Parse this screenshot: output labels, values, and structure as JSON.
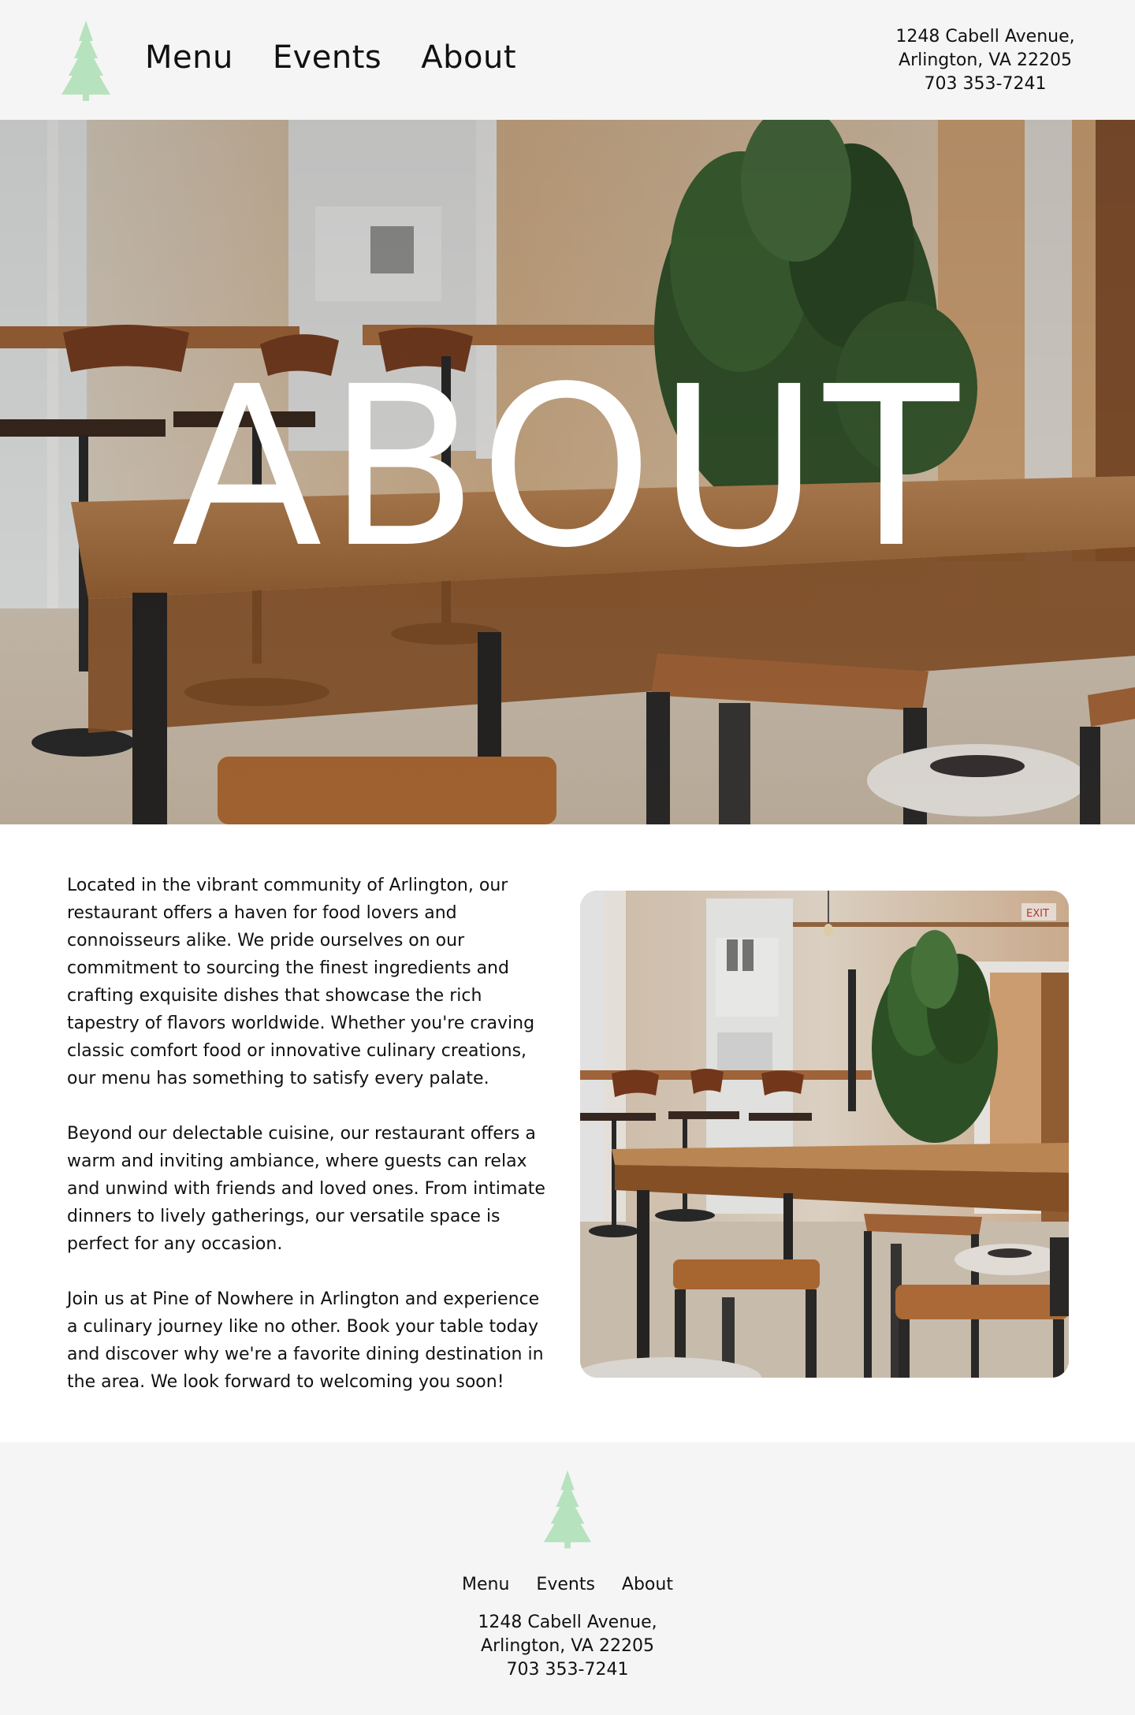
{
  "brand": {
    "logo_icon": "pine-tree-icon",
    "logo_color": "#b6e2bd"
  },
  "header": {
    "nav": [
      {
        "label": "Menu"
      },
      {
        "label": "Events"
      },
      {
        "label": "About"
      }
    ],
    "address": {
      "street": "1248 Cabell Avenue,",
      "city": "Arlington, VA 22205",
      "phone": "703 353-7241"
    }
  },
  "hero": {
    "title": "ABOUT",
    "image_subject": "restaurant-interior-photo"
  },
  "main": {
    "paragraphs": [
      "Located in the vibrant community of Arlington, our restaurant offers a haven for food lovers and connoisseurs alike. We pride ourselves on our commitment to sourcing the finest ingredients and crafting exquisite dishes that showcase the rich tapestry of flavors worldwide. Whether you're craving classic comfort food or innovative culinary creations, our menu has something to satisfy every palate.",
      "Beyond our delectable cuisine, our restaurant offers a warm and inviting ambiance, where guests can relax and unwind with friends and loved ones. From intimate dinners to lively gatherings, our versatile space is perfect for any occasion.",
      "Join us at Pine of Nowhere in Arlington and experience a culinary journey like no other. Book your table today and discover why we're a favorite dining destination in the area. We look forward to welcoming you soon!"
    ],
    "image_subject": "restaurant-dining-room-photo"
  },
  "footer": {
    "nav": [
      {
        "label": "Menu"
      },
      {
        "label": "Events"
      },
      {
        "label": "About"
      }
    ],
    "address": {
      "street": "1248 Cabell Avenue,",
      "city": "Arlington, VA 22205",
      "phone": "703 353-7241"
    }
  }
}
